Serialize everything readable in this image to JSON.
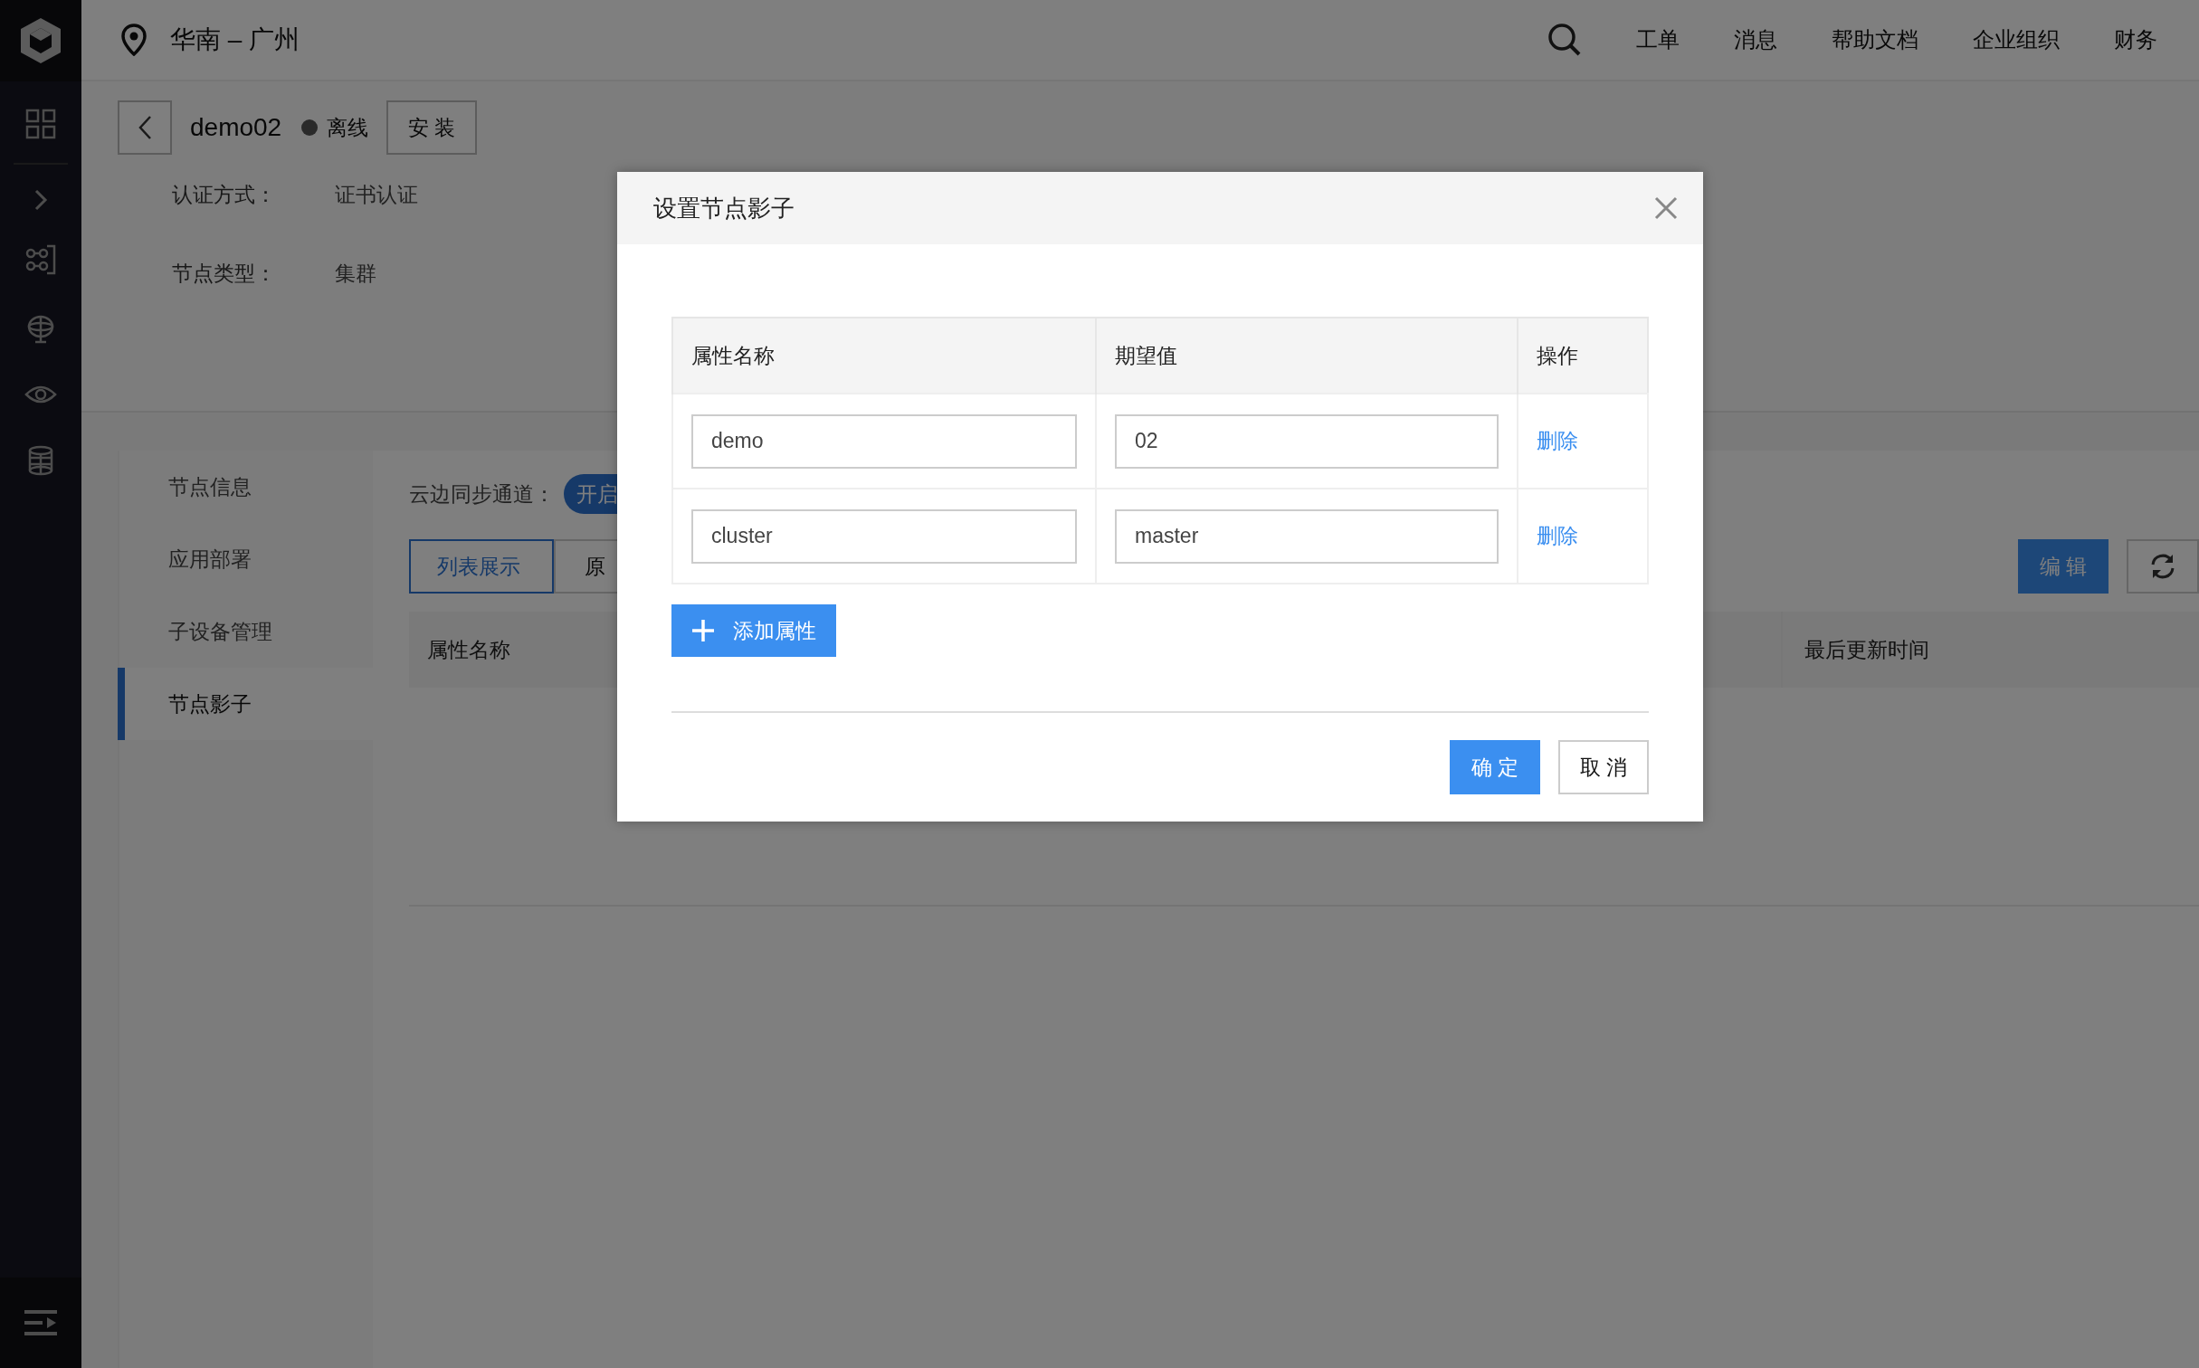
{
  "header": {
    "region": "华南 – 广州",
    "nav": [
      "工单",
      "消息",
      "帮助文档",
      "企业组织",
      "财务"
    ]
  },
  "node": {
    "name": "demo02",
    "status": "离线",
    "online": false,
    "install_button": "安 装"
  },
  "info": [
    {
      "label": "认证方式：",
      "value": "证书认证"
    },
    {
      "label": "节点类型：",
      "value": "集群"
    }
  ],
  "subnav": [
    {
      "label": "节点信息",
      "selected": false
    },
    {
      "label": "应用部署",
      "selected": false
    },
    {
      "label": "子设备管理",
      "selected": false
    },
    {
      "label": "节点影子",
      "selected": true
    }
  ],
  "sync": {
    "label": "云边同步通道：",
    "toggle": "开启",
    "on": true
  },
  "view_tabs": [
    {
      "label": "列表展示",
      "selected": true
    },
    {
      "label": "原",
      "selected": false
    }
  ],
  "edit_button": "编 辑",
  "table_columns": [
    "属性名称",
    "最后更新时间"
  ],
  "dialog": {
    "title": "设置节点影子",
    "columns": [
      "属性名称",
      "期望值",
      "操作"
    ],
    "rows": [
      {
        "name": "demo",
        "value": "02",
        "action": "删除"
      },
      {
        "name": "cluster",
        "value": "master",
        "action": "删除"
      }
    ],
    "add_button": "添加属性",
    "confirm": "确 定",
    "cancel": "取 消"
  }
}
